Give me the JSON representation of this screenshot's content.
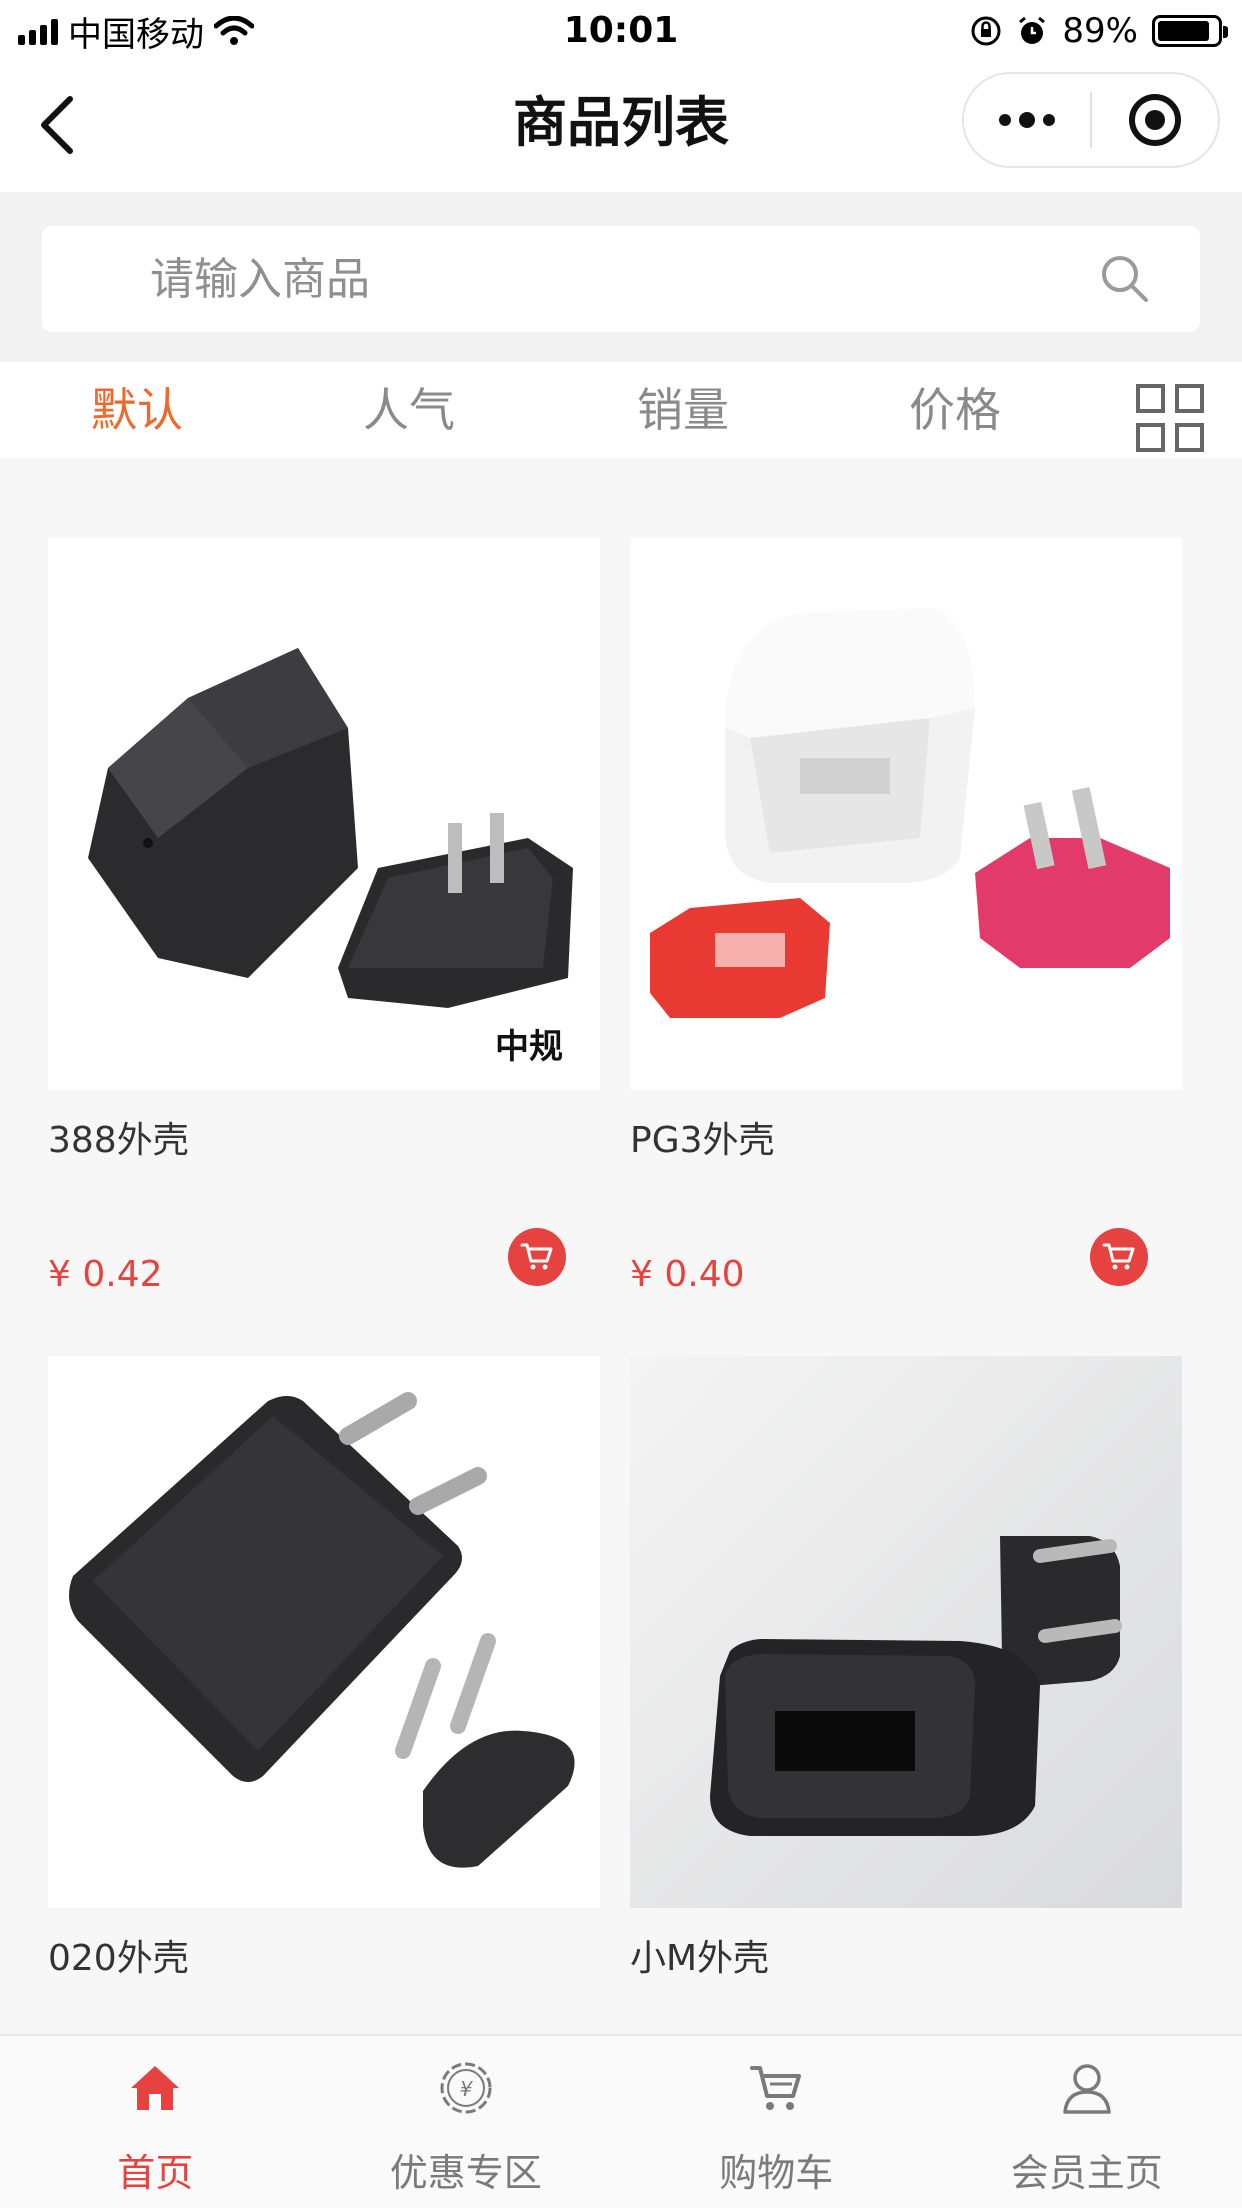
{
  "status_bar": {
    "carrier": "中国移动",
    "time": "10:01",
    "battery": "89%"
  },
  "nav": {
    "title": "商品列表"
  },
  "search": {
    "placeholder": "请输入商品"
  },
  "tabs": [
    {
      "label": "默认",
      "active": true
    },
    {
      "label": "人气",
      "active": false
    },
    {
      "label": "销量",
      "active": false
    },
    {
      "label": "价格",
      "active": false
    }
  ],
  "products": [
    {
      "name": "388外壳",
      "price": "¥ 0.42",
      "image_caption": "中规"
    },
    {
      "name": "PG3外壳",
      "price": "¥ 0.40"
    },
    {
      "name": "020外壳",
      "price": ""
    },
    {
      "name": "小M外壳",
      "price": ""
    }
  ],
  "tabbar": [
    {
      "label": "首页",
      "icon": "home-icon",
      "active": true
    },
    {
      "label": "优惠专区",
      "icon": "coupon-icon",
      "active": false
    },
    {
      "label": "购物车",
      "icon": "cart-icon",
      "active": false
    },
    {
      "label": "会员主页",
      "icon": "user-icon",
      "active": false
    }
  ],
  "colors": {
    "accent_orange": "#ec6a2c",
    "price_red": "#e64340"
  }
}
